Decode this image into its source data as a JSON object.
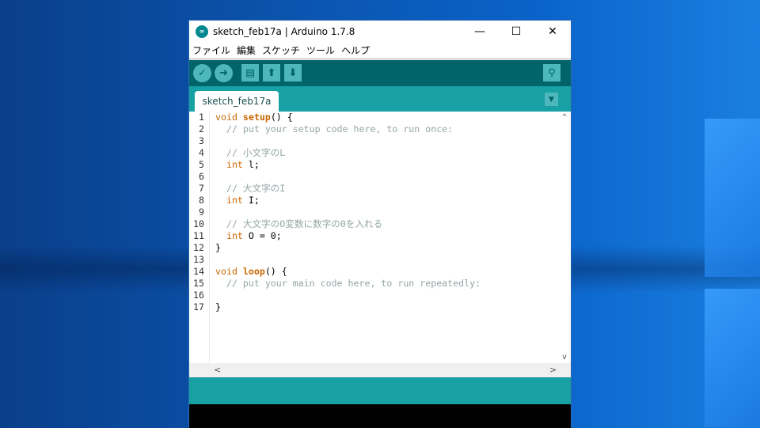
{
  "window": {
    "title": "sketch_feb17a | Arduino 1.7.8",
    "minimize": "—",
    "maximize": "☐",
    "close": "✕"
  },
  "menu": [
    "ファイル",
    "編集",
    "スケッチ",
    "ツール",
    "ヘルプ"
  ],
  "toolbar": {
    "verify": "✓",
    "upload": "➜",
    "new": "▤",
    "open": "⬆",
    "save": "⬇",
    "serial": "⚲"
  },
  "tab": {
    "label": "sketch_feb17a",
    "menu": "▼"
  },
  "scroll": {
    "up": "^",
    "down": "v",
    "left": "<",
    "right": ">"
  },
  "code": [
    [
      [
        "kw",
        "void "
      ],
      [
        "fn",
        "setup"
      ],
      [
        "",
        "() {"
      ]
    ],
    [
      [
        "cm",
        "  // put your setup code here, to run once:"
      ]
    ],
    [],
    [
      [
        "cm",
        "  // 小文字のL"
      ]
    ],
    [
      [
        "kw",
        "  int"
      ],
      [
        "",
        " l;"
      ]
    ],
    [],
    [
      [
        "cm",
        "  // 大文字のI"
      ]
    ],
    [
      [
        "kw",
        "  int"
      ],
      [
        "",
        " I;"
      ]
    ],
    [],
    [
      [
        "cm",
        "  // 大文字のO変数に数字の0を入れる"
      ]
    ],
    [
      [
        "kw",
        "  int"
      ],
      [
        "",
        " O = 0;"
      ]
    ],
    [
      [
        "",
        "}"
      ]
    ],
    [],
    [
      [
        "kw",
        "void "
      ],
      [
        "fn",
        "loop"
      ],
      [
        "",
        "() {"
      ]
    ],
    [
      [
        "cm",
        "  // put your main code here, to run repeatedly:"
      ]
    ],
    [],
    [
      [
        "",
        "}"
      ]
    ]
  ]
}
